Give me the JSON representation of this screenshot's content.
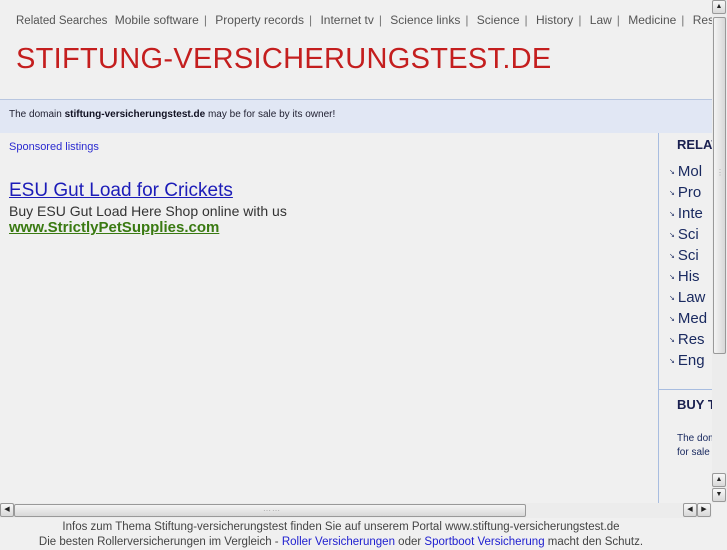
{
  "top_nav": {
    "label": "Related Searches",
    "items": [
      "Mobile software",
      "Property records",
      "Internet tv",
      "Science links",
      "Science",
      "History",
      "Law",
      "Medicine",
      "Research"
    ]
  },
  "site_title": "STIFTUNG-VERSICHERUNGSTEST.DE",
  "sale_notice": {
    "prefix": "The domain",
    "domain": "stiftung-versicherungstest.de",
    "suffix": "may be for sale by its owner!"
  },
  "sponsored_label": "Sponsored listings",
  "ad": {
    "title": "ESU Gut Load for Crickets",
    "description": "Buy ESU Gut Load Here Shop online with us",
    "url": "www.StrictlyPetSupplies.com"
  },
  "right_column": {
    "heading": "RELAT",
    "items": [
      "Mol",
      "Pro",
      "Inte",
      "Sci",
      "Sci",
      "His",
      "Law",
      "Med",
      "Res",
      "Eng"
    ],
    "buy_heading": "BUY T",
    "buy_text_1": "The dom",
    "buy_text_2": "for sale"
  },
  "footer": {
    "line1": "Infos zum Thema Stiftung-versicherungstest finden Sie auf unserem Portal www.stiftung-versicherungstest.de",
    "line2_prefix": "Die besten Rollerversicherungen im Vergleich - ",
    "link1": "Roller Versicherungen",
    "middle": " oder ",
    "link2": "Sportboot Versicherung",
    "line2_suffix": " macht den Schutz."
  },
  "colors": {
    "title": "#c41e1e",
    "link": "#1c1cb8",
    "ad_url": "#3a7a12",
    "band": "#e1e7f4"
  }
}
